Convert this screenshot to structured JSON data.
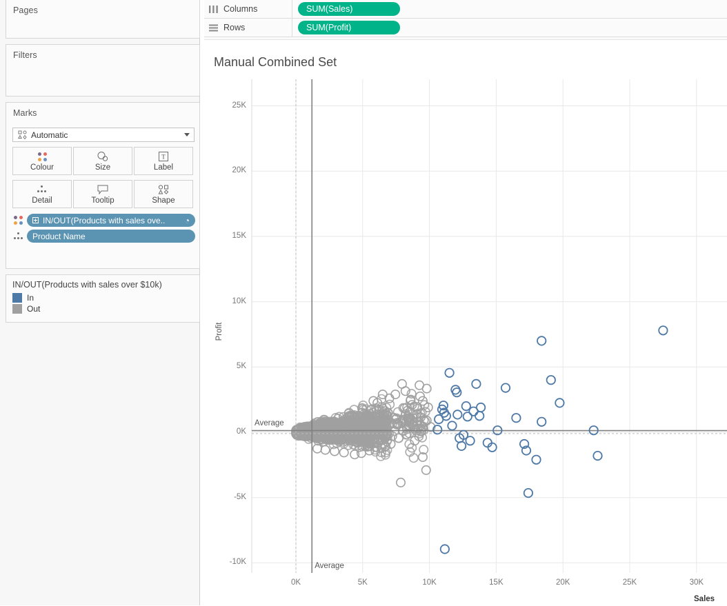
{
  "shelves": {
    "columns": {
      "label": "Columns",
      "icon": "columns-icon",
      "pill": "SUM(Sales)"
    },
    "rows": {
      "label": "Rows",
      "icon": "rows-icon",
      "pill": "SUM(Profit)"
    },
    "pill_color": "#00b388"
  },
  "left_panel": {
    "pages": {
      "title": "Pages"
    },
    "filters": {
      "title": "Filters"
    },
    "marks": {
      "title": "Marks",
      "type_selector": {
        "value": "Automatic",
        "icon": "marks-type-icon",
        "caret": "chevron-down-icon"
      },
      "buttons": [
        {
          "name": "colour",
          "label": "Colour",
          "icon": "colour-dots-icon"
        },
        {
          "name": "size",
          "label": "Size",
          "icon": "size-icon"
        },
        {
          "name": "label",
          "label": "Label",
          "icon": "label-icon"
        },
        {
          "name": "detail",
          "label": "Detail",
          "icon": "detail-dots-icon"
        },
        {
          "name": "tooltip",
          "label": "Tooltip",
          "icon": "tooltip-icon"
        },
        {
          "name": "shape",
          "label": "Shape",
          "icon": "shape-icon"
        }
      ],
      "pills": [
        {
          "shelf": "colour",
          "text": "IN/OUT(Products with sales ove..",
          "set_icon": "set-icon",
          "prefix_icon": "plus-box-icon"
        },
        {
          "shelf": "detail",
          "text": "Product Name"
        }
      ],
      "pill_color": "#5b93b3"
    },
    "legend": {
      "title": "IN/OUT(Products with sales over $10k)",
      "items": [
        {
          "label": "In",
          "color": "#4e79a7"
        },
        {
          "label": "Out",
          "color": "#a0a0a0"
        }
      ]
    }
  },
  "viz": {
    "title": "Manual Combined Set",
    "reference_lines": {
      "vertical_label": "Average",
      "horizontal_label": "Average"
    }
  },
  "chart_data": {
    "type": "scatter",
    "title": "Manual Combined Set",
    "xlabel": "Sales",
    "ylabel": "Profit",
    "xlim": [
      -2000,
      31500
    ],
    "ylim": [
      -11500,
      27000
    ],
    "xticks": [
      0,
      5000,
      10000,
      15000,
      20000,
      25000,
      30000
    ],
    "xticklabels": [
      "0K",
      "5K",
      "10K",
      "15K",
      "20K",
      "25K",
      "30K"
    ],
    "yticks": [
      -10000,
      -5000,
      0,
      5000,
      10000,
      15000,
      20000,
      25000
    ],
    "yticklabels": [
      "-10K",
      "-5K",
      "0K",
      "5K",
      "10K",
      "15K",
      "20K",
      "25K"
    ],
    "grid": true,
    "legend_position": "left-panel",
    "reference_lines": [
      {
        "orientation": "vertical",
        "label": "Average",
        "value": 1200,
        "style": "solid",
        "color": "#808080"
      },
      {
        "orientation": "horizontal",
        "label": "Average",
        "value": 130,
        "style": "solid",
        "color": "#808080"
      },
      {
        "orientation": "vertical",
        "label": "",
        "value": 0,
        "style": "dashed",
        "color": "#bbbbbb"
      },
      {
        "orientation": "horizontal",
        "label": "",
        "value": -100,
        "style": "dashed",
        "color": "#bbbbbb"
      }
    ],
    "series": [
      {
        "name": "In",
        "color": "#4e79a7",
        "points": [
          [
            27500,
            7800
          ],
          [
            18400,
            7000
          ],
          [
            11500,
            4550
          ],
          [
            19100,
            4000
          ],
          [
            13500,
            3700
          ],
          [
            15700,
            3400
          ],
          [
            12050,
            3050
          ],
          [
            11950,
            3250
          ],
          [
            19750,
            2250
          ],
          [
            12750,
            2000
          ],
          [
            13850,
            1900
          ],
          [
            10950,
            1750
          ],
          [
            11100,
            1500
          ],
          [
            11050,
            2050
          ],
          [
            13300,
            1600
          ],
          [
            12850,
            1200
          ],
          [
            16500,
            1100
          ],
          [
            10700,
            1000
          ],
          [
            18400,
            800
          ],
          [
            11700,
            500
          ],
          [
            10600,
            200
          ],
          [
            15100,
            150
          ],
          [
            22300,
            150
          ],
          [
            12550,
            -200
          ],
          [
            13050,
            -650
          ],
          [
            12250,
            -450
          ],
          [
            14350,
            -800
          ],
          [
            17100,
            -900
          ],
          [
            17250,
            -1400
          ],
          [
            18000,
            -2100
          ],
          [
            22600,
            -1800
          ],
          [
            17400,
            -4650
          ],
          [
            11150,
            -8950
          ],
          [
            12400,
            -1050
          ],
          [
            14700,
            -1150
          ],
          [
            11250,
            1250
          ],
          [
            12100,
            1350
          ],
          [
            13750,
            1250
          ]
        ]
      },
      {
        "name": "Out",
        "color": "#a0a0a0",
        "points_note": "Dense cluster of ~1800 product marks centred near Sales 0-6K, Profit -1K to 1K, with a fan of outliers out to ~10K sales.",
        "outliers": [
          [
            7950,
            3700
          ],
          [
            9250,
            3600
          ],
          [
            9800,
            3350
          ],
          [
            9300,
            2750
          ],
          [
            8200,
            3150
          ],
          [
            7450,
            2900
          ],
          [
            8600,
            2500
          ],
          [
            9500,
            2400
          ],
          [
            9900,
            1900
          ],
          [
            9350,
            1150
          ],
          [
            9800,
            900
          ],
          [
            9200,
            300
          ],
          [
            8900,
            -650
          ],
          [
            9500,
            -1900
          ],
          [
            9750,
            -2900
          ],
          [
            7850,
            -3850
          ],
          [
            6500,
            2900
          ],
          [
            7000,
            2600
          ],
          [
            6100,
            2250
          ],
          [
            5800,
            2400
          ],
          [
            6900,
            1500
          ],
          [
            7500,
            1000
          ],
          [
            6400,
            -1200
          ],
          [
            7100,
            -900
          ],
          [
            5500,
            -1400
          ],
          [
            4900,
            -1600
          ],
          [
            4400,
            -1700
          ],
          [
            3600,
            -1550
          ],
          [
            2900,
            -1450
          ],
          [
            2200,
            -1350
          ],
          [
            1600,
            -1250
          ],
          [
            8350,
            1650
          ],
          [
            8700,
            2100
          ],
          [
            9050,
            1400
          ],
          [
            10100,
            400
          ]
        ]
      }
    ]
  }
}
